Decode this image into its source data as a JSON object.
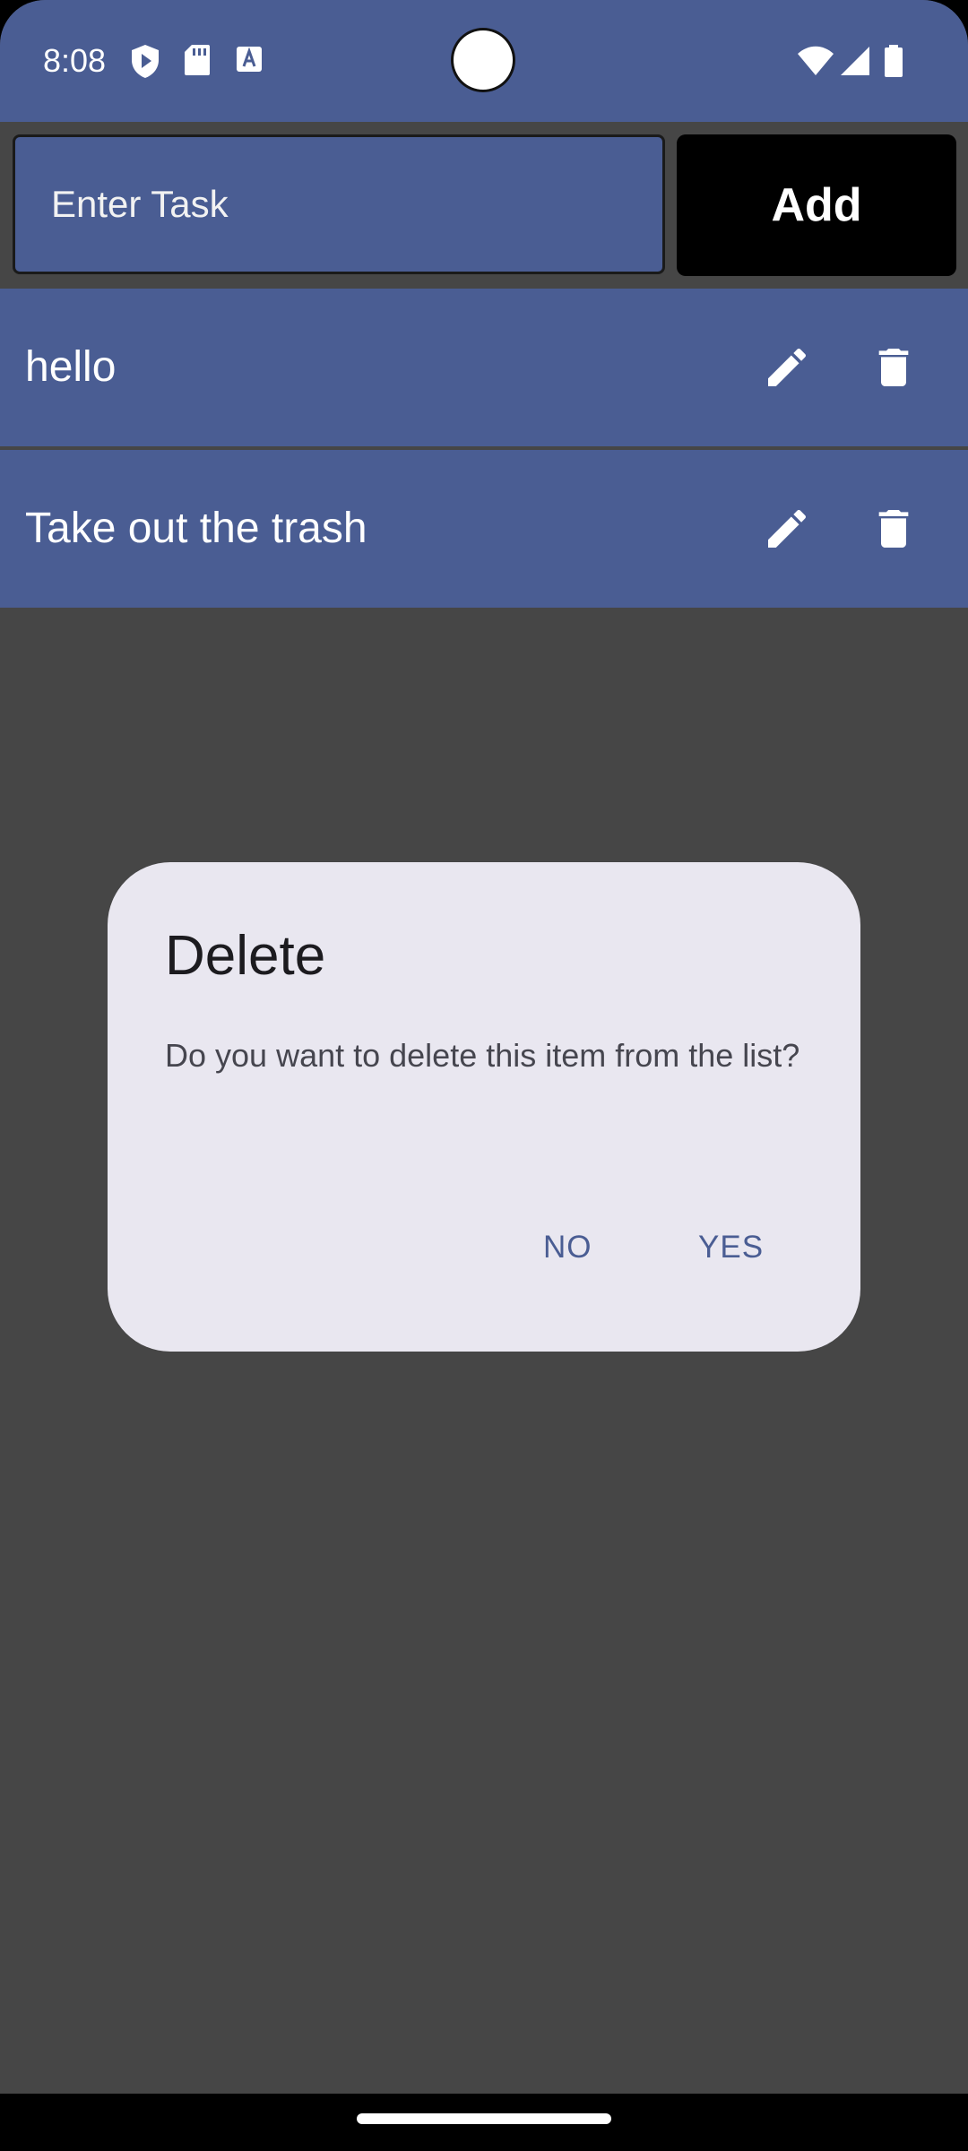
{
  "status_bar": {
    "time": "8:08",
    "left_icons": [
      "shield-play-icon",
      "sd-card-icon",
      "text-box-icon"
    ],
    "right_icons": [
      "wifi-icon",
      "cell-signal-icon",
      "battery-icon"
    ]
  },
  "input": {
    "placeholder": "Enter Task",
    "value": ""
  },
  "add_button": {
    "label": "Add"
  },
  "tasks": [
    {
      "label": "hello",
      "edit_icon": "pencil-icon",
      "delete_icon": "trash-icon"
    },
    {
      "label": "Take out the trash",
      "edit_icon": "pencil-icon",
      "delete_icon": "trash-icon"
    }
  ],
  "dialog": {
    "title": "Delete",
    "message": "Do you want to delete this item from the list?",
    "negative_label": "NO",
    "positive_label": "YES"
  },
  "colors": {
    "primary": "#4a5d93",
    "scrim": "#464646",
    "dialog_bg": "#e9e7f0"
  }
}
